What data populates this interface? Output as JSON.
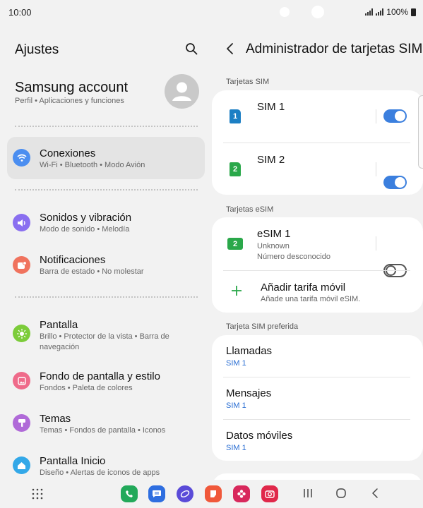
{
  "status": {
    "time": "10:00",
    "battery": "100%"
  },
  "left": {
    "title": "Ajustes",
    "account": {
      "name": "Samsung account",
      "sub": "Perfil • Aplicaciones y funciones"
    },
    "items": [
      {
        "title": "Conexiones",
        "sub": "Wi-Fi • Bluetooth • Modo Avión",
        "icon": "wifi-icon",
        "color": "#4b8ef0"
      },
      {
        "title": "Sonidos y vibración",
        "sub": "Modo de sonido • Melodía",
        "icon": "sound-icon",
        "color": "#8a6ff0"
      },
      {
        "title": "Notificaciones",
        "sub": "Barra de estado • No molestar",
        "icon": "notification-icon",
        "color": "#f0735e"
      },
      {
        "title": "Pantalla",
        "sub": "Brillo • Protector de la vista • Barra de navegación",
        "icon": "brightness-icon",
        "color": "#7ccc3a"
      },
      {
        "title": "Fondo de pantalla y estilo",
        "sub": "Fondos • Paleta de colores",
        "icon": "wallpaper-icon",
        "color": "#ef6b8a"
      },
      {
        "title": "Temas",
        "sub": "Temas • Fondos de pantalla • Iconos",
        "icon": "themes-icon",
        "color": "#b06ad8"
      },
      {
        "title": "Pantalla Inicio",
        "sub": "Diseño • Alertas de iconos de apps",
        "icon": "home-icon",
        "color": "#33a8e8"
      }
    ]
  },
  "right": {
    "title": "Administrador de tarjetas SIM",
    "sim_section": "Tarjetas SIM",
    "sims": [
      {
        "label": "SIM 1",
        "badge": "1",
        "badge_color": "#1c7fc4",
        "enabled": true
      },
      {
        "label": "SIM 2",
        "badge": "2",
        "badge_color": "#2aa84a",
        "enabled": true
      }
    ],
    "esim_section": "Tarjetas eSIM",
    "esim": {
      "label": "eSIM 1",
      "badge": "2",
      "line1": "Unknown",
      "line2": "Número desconocido",
      "enabled": false
    },
    "add": {
      "label": "Añadir tarifa móvil",
      "sub": "Añade una tarifa móvil eSIM."
    },
    "preferred_section": "Tarjeta SIM preferida",
    "preferred": [
      {
        "label": "Llamadas",
        "value": "SIM 1"
      },
      {
        "label": "Mensajes",
        "value": "SIM 1"
      },
      {
        "label": "Datos móviles",
        "value": "SIM 1"
      }
    ]
  },
  "dock": [
    {
      "icon": "phone-icon",
      "color": "#22a95a"
    },
    {
      "icon": "messages-icon",
      "color": "#2e6ee0"
    },
    {
      "icon": "internet-icon",
      "color": "#5a4bd8"
    },
    {
      "icon": "notes-icon",
      "color": "#f0583a"
    },
    {
      "icon": "gallery-icon",
      "color": "#d8285c"
    },
    {
      "icon": "camera-icon",
      "color": "#e0284a"
    }
  ]
}
